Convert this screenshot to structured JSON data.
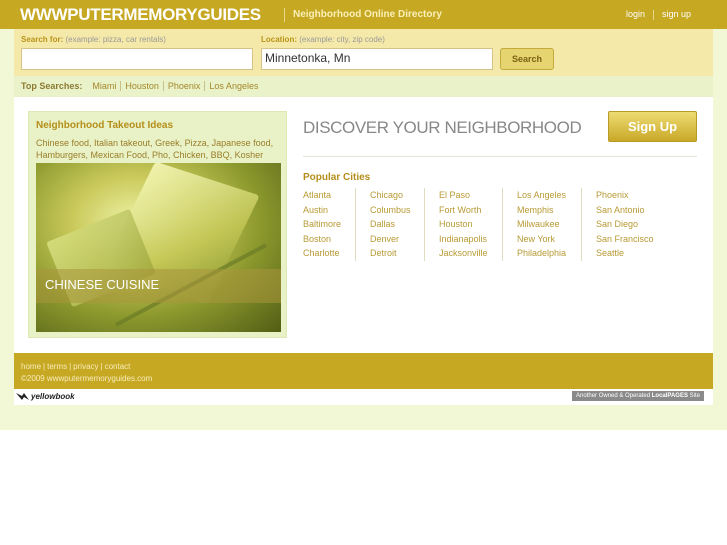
{
  "header": {
    "logo": "WWWPUTERMEMORYGUIDES",
    "tagline": "Neighborhood Online Directory",
    "login": "login",
    "signup": "sign up"
  },
  "search": {
    "search_label": "Search for:",
    "search_hint": "(example: pizza, car rentals)",
    "search_value": "",
    "location_label": "Location:",
    "location_hint": "(example: city, zip code)",
    "location_value": "Minnetonka, Mn",
    "button": "Search"
  },
  "top_searches": {
    "label": "Top Searches:",
    "items": [
      "Miami",
      "Houston",
      "Phoenix",
      "Los Angeles"
    ]
  },
  "promo": {
    "title": "Neighborhood Takeout Ideas",
    "subtitle": "Chinese food, Italian takeout, Greek, Pizza, Japanese food, Hamburgers, Mexican Food, Pho, Chicken, BBQ, Kosher",
    "image_caption": "CHINESE CUISINE"
  },
  "main": {
    "heading": "DISCOVER YOUR NEIGHBORHOOD",
    "signup_button": "Sign Up",
    "cities_title": "Popular Cities",
    "city_columns": [
      [
        "Atlanta",
        "Austin",
        "Baltimore",
        "Boston",
        "Charlotte"
      ],
      [
        "Chicago",
        "Columbus",
        "Dallas",
        "Denver",
        "Detroit"
      ],
      [
        "El Paso",
        "Fort Worth",
        "Houston",
        "Indianapolis",
        "Jacksonville"
      ],
      [
        "Los Angeles",
        "Memphis",
        "Milwaukee",
        "New York",
        "Philadelphia"
      ],
      [
        "Phoenix",
        "San Antonio",
        "San Diego",
        "San Francisco",
        "Seattle"
      ]
    ]
  },
  "footer": {
    "links": [
      "home",
      "terms",
      "privacy",
      "contact"
    ],
    "copyright": "©2009 wwwputermemoryguides.com"
  },
  "bottom": {
    "brand": "yellowbook",
    "badge_prefix": "Another Owned & Operated ",
    "badge_brand": "LocalPAGES",
    "badge_suffix": " Site"
  },
  "colors": {
    "brand_gold": "#c6a823",
    "link_gold": "#b89a35",
    "page_bg": "#f2f7d6"
  },
  "icons": {
    "yellowbook_logo": "yellowbook-logo-icon"
  }
}
